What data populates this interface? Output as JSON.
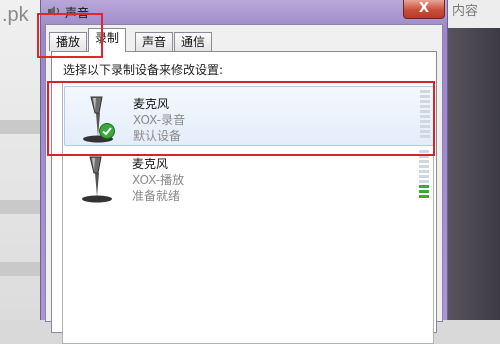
{
  "background": {
    "left_text": ".pk",
    "right_text": "内容"
  },
  "window": {
    "title": "声音",
    "close_label": "X"
  },
  "tabs": [
    {
      "label": "播放"
    },
    {
      "label": "录制"
    },
    {
      "label": "声音"
    },
    {
      "label": "通信"
    }
  ],
  "active_tab": "录制",
  "instruction": "选择以下录制设备来修改设置:",
  "devices": [
    {
      "name": "麦克风",
      "description": "XOX-录音",
      "status": "默认设备",
      "default": true,
      "selected": true,
      "meter_level": 0
    },
    {
      "name": "麦克风",
      "description": "XOX-播放",
      "status": "准备就绪",
      "default": false,
      "selected": false,
      "meter_level": 0.3
    }
  ],
  "colors": {
    "highlight": "#e0262e",
    "check": "#3aa83a",
    "titlebar": "#a996d2"
  }
}
